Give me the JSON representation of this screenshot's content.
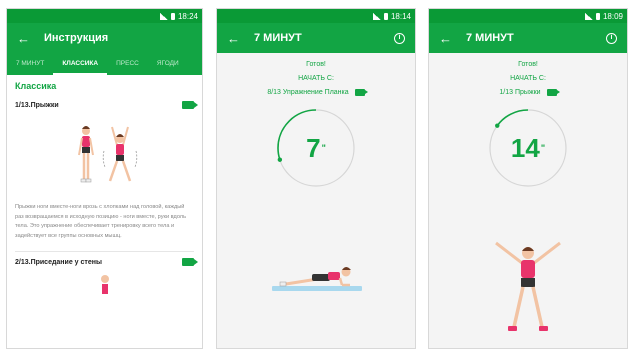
{
  "colors": {
    "primary": "#12a544",
    "status": "#0a9a36",
    "accent_pink": "#e8336b"
  },
  "screen1": {
    "time": "18:24",
    "title": "Инструкция",
    "tabs": [
      "7 МИНУТ",
      "КЛАССИКА",
      "ПРЕСС",
      "ЯГОДИ"
    ],
    "active_tab": "КЛАССИКА",
    "section_title": "Классика",
    "exercise1": {
      "name": "1/13.Прыжки",
      "description": "Прыжки ноги вместе-ноги врозь с хлопками над головой, каждый раз возвращаемся в исходную позицию - ноги вместе, руки вдоль тела. Это упражнение обеспечивает тренировку всего тела и задействует все группы основных мышц."
    },
    "exercise2": {
      "name": "2/13.Приседание у стены"
    }
  },
  "screen2": {
    "time": "18:14",
    "title": "7 МИНУТ",
    "ready": "Готов!",
    "start_from": "НАЧАТЬ С:",
    "current": "8/13 Упражнение Планка",
    "seconds": "7",
    "unit": "\"",
    "progress": 0.3
  },
  "screen3": {
    "time": "18:09",
    "title": "7 МИНУТ",
    "ready": "Готов!",
    "start_from": "НАЧАТЬ С:",
    "current": "1/13 Прыжки",
    "seconds": "14",
    "unit": "\"",
    "progress": 0.15
  },
  "icons": {
    "back": "arrow-left-icon",
    "info": "info-icon",
    "video": "video-camera-icon"
  }
}
